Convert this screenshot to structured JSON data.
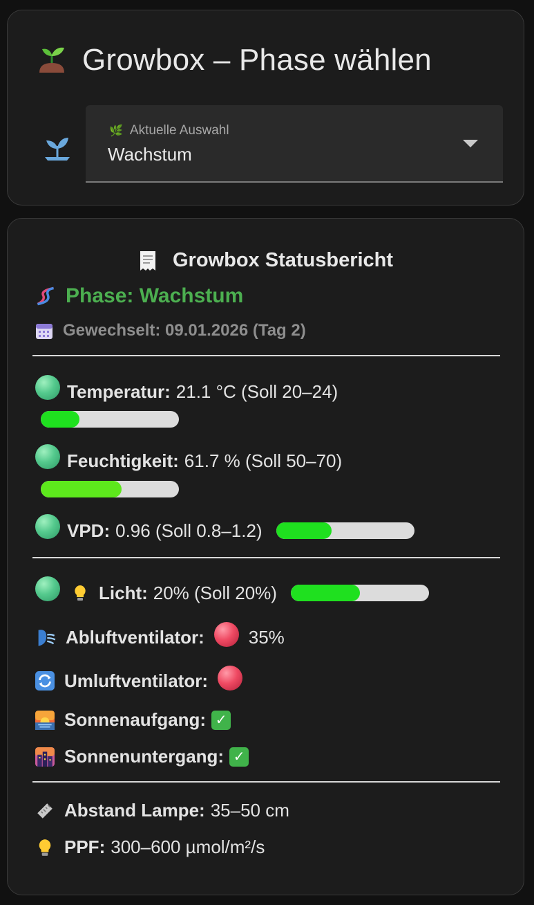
{
  "header": {
    "title": "Growbox – Phase wählen"
  },
  "phase_select": {
    "label": "Aktuelle Auswahl",
    "value": "Wachstum"
  },
  "report": {
    "title": "Growbox Statusbericht",
    "phase_label": "Phase: Wachstum",
    "changed_label": "Gewechselt: 09.01.2026 (Tag 2)",
    "temperature": {
      "label": "Temperatur:",
      "value": "21.1 °C (Soll 20–24)",
      "level": 0.28,
      "bar_color": "#1fe01f"
    },
    "humidity": {
      "label": "Feuchtigkeit:",
      "value": "61.7 % (Soll 50–70)",
      "level": 0.585,
      "bar_color": "#5de81c"
    },
    "vpd": {
      "label": "VPD:",
      "value": "0.96 (Soll 0.8–1.2)",
      "level": 0.4,
      "bar_color": "#1fe01f"
    },
    "light": {
      "label": "Licht:",
      "value": "20% (Soll 20%)",
      "level": 0.5,
      "bar_color": "#1fe01f"
    },
    "exhaust_fan": {
      "label": "Abluftventilator:",
      "value": "35%"
    },
    "circulation_fan": {
      "label": "Umluftventilator:"
    },
    "sunrise": {
      "label": "Sonnenaufgang:"
    },
    "sunset": {
      "label": "Sonnenuntergang:"
    },
    "lamp_distance": {
      "label": "Abstand Lampe:",
      "value": "35–50 cm"
    },
    "ppf": {
      "label": "PPF:",
      "value": "300–600 µmol/m²/s"
    }
  },
  "colors": {
    "accent_green": "#4caf50",
    "status_ok": "#54c98d",
    "status_off": "#ef4a63"
  },
  "icons": {
    "title": "seedling-icon",
    "select": "sprout-icon",
    "report": "receipt-icon",
    "phase": "dna-icon",
    "changed": "calendar-icon",
    "light": "lightbulb-icon",
    "exhaust": "wind-face-icon",
    "circulation": "cycle-arrows-icon",
    "sunrise": "sunrise-icon",
    "sunset": "city-dusk-icon",
    "lamp_distance": "ruler-icon",
    "ppf": "lightbulb-icon"
  }
}
